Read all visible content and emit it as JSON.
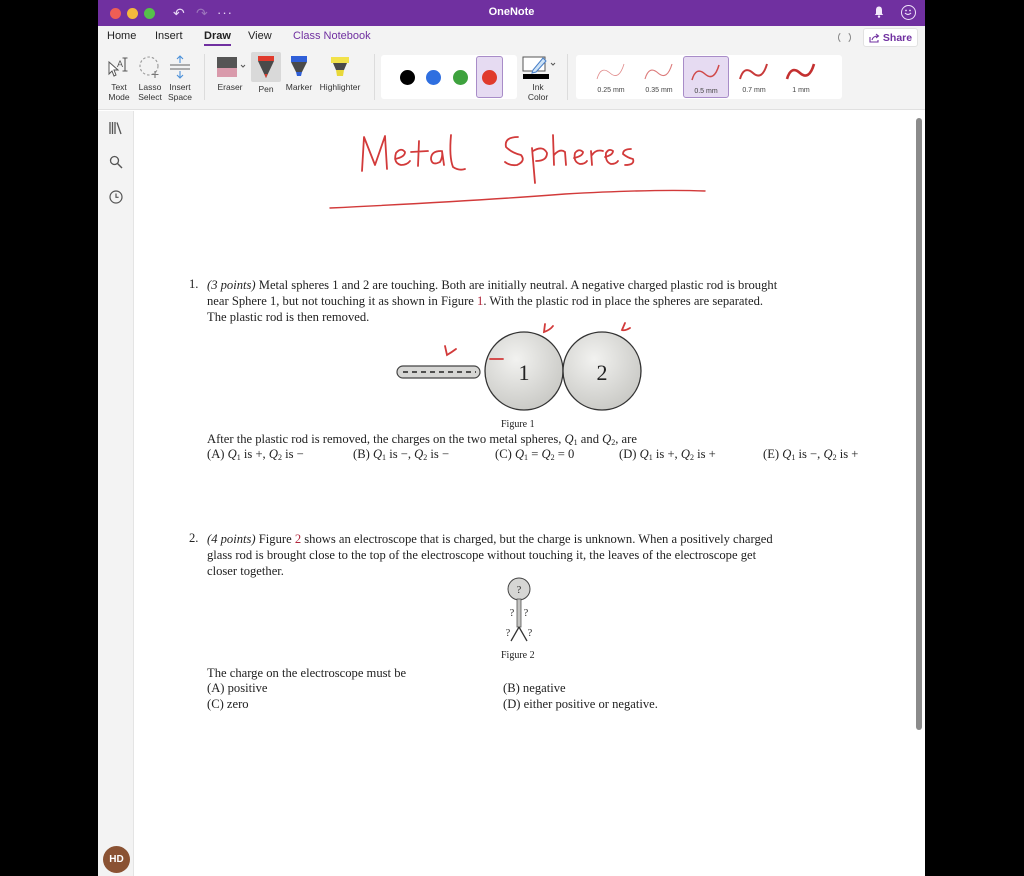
{
  "titlebar": {
    "app_title": "OneNote",
    "undo_icon": "undo-icon",
    "redo_icon": "redo-icon",
    "more_icon": "more-icon",
    "notification_icon": "bell-icon",
    "feedback_icon": "smiley-icon",
    "color": "#7030a0"
  },
  "ribbon": {
    "tabs": [
      {
        "label": "Home",
        "active": false
      },
      {
        "label": "Insert",
        "active": false
      },
      {
        "label": "Draw",
        "active": true
      },
      {
        "label": "View",
        "active": false
      },
      {
        "label": "Class Notebook",
        "active": false
      }
    ],
    "share_label": "Share",
    "tools": {
      "text_mode": "Text\nMode",
      "text_mode_l1": "Text",
      "text_mode_l2": "Mode",
      "lasso_l1": "Lasso",
      "lasso_l2": "Select",
      "insert_space_l1": "Insert",
      "insert_space_l2": "Space",
      "eraser": "Eraser",
      "pen": "Pen",
      "marker": "Marker",
      "highlighter": "Highlighter",
      "ink_color_l1": "Ink",
      "ink_color_l2": "Color"
    },
    "colors": [
      {
        "name": "black",
        "hex": "#000000",
        "selected": false
      },
      {
        "name": "blue",
        "hex": "#2f6fe0",
        "selected": false
      },
      {
        "name": "green",
        "hex": "#3ea23e",
        "selected": false
      },
      {
        "name": "red",
        "hex": "#e03a2c",
        "selected": true
      }
    ],
    "stroke_widths": [
      {
        "label": "0.25 mm",
        "selected": false
      },
      {
        "label": "0.35 mm",
        "selected": false
      },
      {
        "label": "0.5 mm",
        "selected": true
      },
      {
        "label": "0.7 mm",
        "selected": false
      },
      {
        "label": "1 mm",
        "selected": false
      }
    ]
  },
  "sidebar": {
    "items": [
      {
        "icon": "notebooks-icon"
      },
      {
        "icon": "search-icon"
      },
      {
        "icon": "recent-icon"
      }
    ],
    "avatar_initials": "HD"
  },
  "page": {
    "handwritten_title": "Metal Spheres",
    "ink_color": "#d23a3a",
    "q1": {
      "number": "1.",
      "points": "(3 points)",
      "line1": " Metal spheres 1 and 2 are touching. Both are initially neutral. A negative charged plastic rod is brought",
      "line2a": "near Sphere 1, but not touching it as shown in Figure ",
      "line2_ref": "1",
      "line2b": ". With the plastic rod in place the spheres are separated.",
      "line3": "The plastic rod is then removed.",
      "figure": {
        "sphere1_label": "1",
        "sphere2_label": "2",
        "caption": "Figure 1"
      },
      "prompt": "After the plastic rod is removed, the charges on the two metal spheres, Q1 and Q2, are",
      "options": [
        "(A) Q1 is +, Q2 is −",
        "(B) Q1 is −, Q2 is −",
        "(C) Q1 = Q2 = 0",
        "(D) Q1 is +, Q2 is +",
        "(E) Q1 is −, Q2 is +"
      ]
    },
    "q2": {
      "number": "2.",
      "points": "(4 points)",
      "line1a": " Figure ",
      "line1_ref": "2",
      "line1b": " shows an electroscope that is charged, but the charge is unknown. When a positively charged",
      "line2": "glass rod is brought close to the top of the electroscope without touching it, the leaves of the electroscope get",
      "line3": "closer together.",
      "figure": {
        "mark": "?",
        "caption": "Figure 2"
      },
      "prompt": "The charge on the electroscope must be",
      "options": [
        "(A) positive",
        "(B) negative",
        "(C) zero",
        "(D) either positive or negative."
      ]
    }
  }
}
